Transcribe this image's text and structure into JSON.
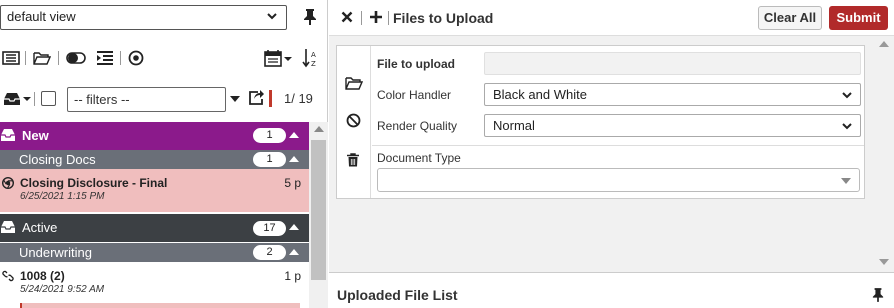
{
  "left": {
    "view_select": "default view",
    "filters_placeholder": "-- filters --",
    "count": "1/ 19",
    "groups": [
      {
        "label": "New",
        "badge": "1",
        "color": "#8b1a8b",
        "sub": {
          "label": "Closing Docs",
          "badge": "1",
          "color": "#6a6f78"
        },
        "items": [
          {
            "title": "Closing Disclosure - Final",
            "date": "6/25/2021 1:15 PM",
            "pages": "5 p",
            "bg": "#f0bebe"
          }
        ]
      },
      {
        "label": "Active",
        "badge": "17",
        "color": "#3c4044",
        "sub": {
          "label": "Underwriting",
          "badge": "2",
          "color": "#6a6f78"
        },
        "items": [
          {
            "title": "1008 (2)",
            "date": "5/24/2021 9:52 AM",
            "pages": "1 p",
            "bg": "#ffffff"
          }
        ]
      }
    ]
  },
  "right": {
    "title": "Files to Upload",
    "clear_all": "Clear All",
    "submit": "Submit",
    "form": {
      "file_label": "File to upload",
      "color_label": "Color Handler",
      "color_value": "Black and White",
      "quality_label": "Render Quality",
      "quality_value": "Normal",
      "doctype_label": "Document Type"
    },
    "uploaded_title": "Uploaded File List"
  },
  "colors": {
    "submit": "#b12a2a",
    "new_group": "#8b1a8b",
    "active_group": "#3c4044",
    "sub_group": "#6a6f78",
    "selected_item": "#f0bebe"
  }
}
